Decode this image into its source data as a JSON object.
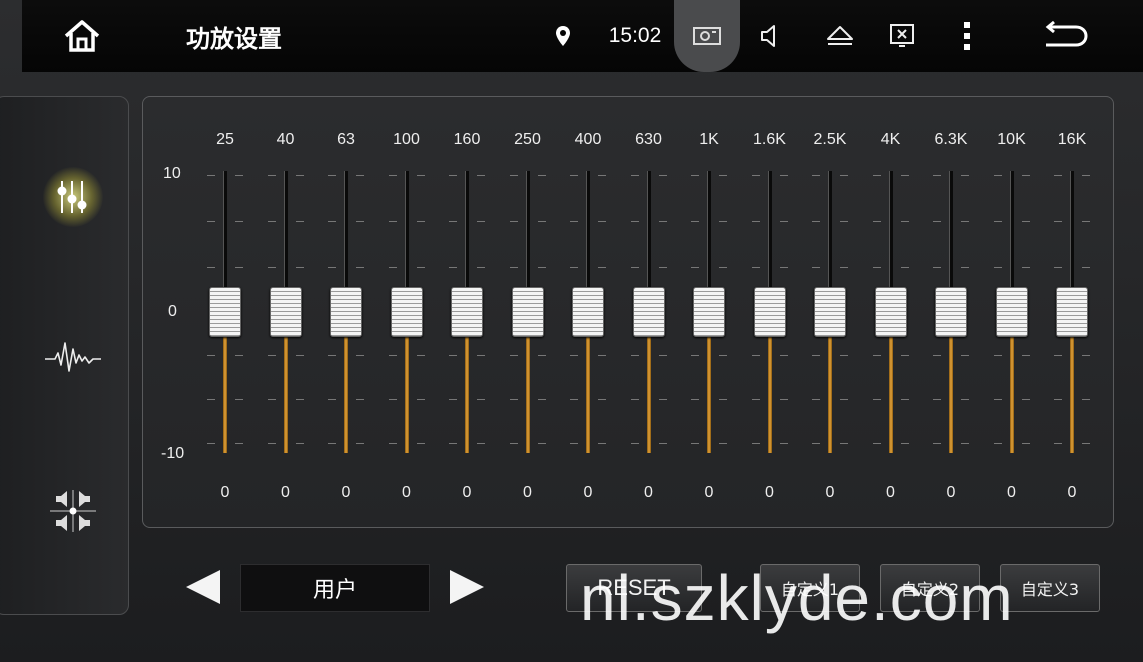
{
  "statusbar": {
    "title": "功放设置",
    "time": "15:02",
    "icons": [
      "home-icon",
      "location-pin-icon",
      "camera-icon",
      "volume-icon",
      "eject-icon",
      "screen-off-icon",
      "more-vert-icon",
      "back-icon"
    ]
  },
  "sidebar": {
    "items": [
      {
        "name": "equalizer-icon",
        "active": true
      },
      {
        "name": "waveform-icon",
        "active": false
      },
      {
        "name": "speaker-balance-icon",
        "active": false
      }
    ]
  },
  "equalizer": {
    "db_labels": {
      "max": "10",
      "mid": "0",
      "min": "-10"
    },
    "range": [
      -10,
      10
    ],
    "bands": [
      {
        "freq": "25",
        "value": "0"
      },
      {
        "freq": "40",
        "value": "0"
      },
      {
        "freq": "63",
        "value": "0"
      },
      {
        "freq": "100",
        "value": "0"
      },
      {
        "freq": "160",
        "value": "0"
      },
      {
        "freq": "250",
        "value": "0"
      },
      {
        "freq": "400",
        "value": "0"
      },
      {
        "freq": "630",
        "value": "0"
      },
      {
        "freq": "1K",
        "value": "0"
      },
      {
        "freq": "1.6K",
        "value": "0"
      },
      {
        "freq": "2.5K",
        "value": "0"
      },
      {
        "freq": "4K",
        "value": "0"
      },
      {
        "freq": "6.3K",
        "value": "0"
      },
      {
        "freq": "10K",
        "value": "0"
      },
      {
        "freq": "16K",
        "value": "0"
      }
    ]
  },
  "controls": {
    "preset": "用户",
    "reset": "RESET",
    "custom1": "自定义1",
    "custom2": "自定义2",
    "custom3": "自定义3"
  },
  "watermark": "nl.szklyde.com",
  "colors": {
    "accent_glow": "#f0e060",
    "track_fill": "#e6a53a"
  }
}
